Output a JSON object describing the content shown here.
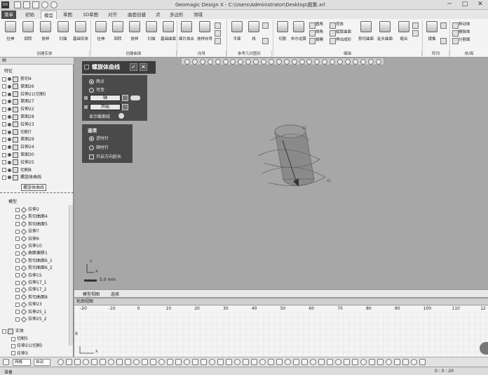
{
  "window": {
    "title": "Geomagic Design X - C:\\Users\\Administrator\\Desktop\\题集.xrl",
    "app_icon": "DX",
    "minimize": "─",
    "maximize": "□",
    "close": "✕"
  },
  "menu_tabs": [
    "菜单",
    "初始",
    "模型",
    "草图",
    "3D草图",
    "对齐",
    "曲面创建",
    "点",
    "多边形",
    "领域"
  ],
  "active_tab": "模型",
  "ribbon": {
    "create_solid": {
      "label": "创建实体",
      "buttons": [
        "拉伸",
        "回转",
        "放样",
        "扫描",
        "基础实体"
      ]
    },
    "create_surface": {
      "label": "创建曲面",
      "buttons": [
        "拉伸",
        "回转",
        "放样",
        "扫描",
        "基础曲面"
      ]
    },
    "wizard": {
      "label": "向导",
      "buttons": [
        "面片拟合",
        "放样向导"
      ]
    },
    "ref_geometry": {
      "label": "参考几何图形",
      "buttons": [
        "平面",
        "线"
      ]
    },
    "edit": {
      "label": "编辑",
      "buttons": [
        "切割",
        "布尔运算"
      ],
      "small": [
        "圆角",
        "倒角",
        "拔模",
        "壳体",
        "赋厚曲面",
        "押出成形"
      ]
    },
    "edit2": {
      "buttons": [
        "剪切曲面",
        "延长曲面",
        "缝合"
      ]
    },
    "array": {
      "label": "阵列",
      "buttons": [
        "镜像"
      ]
    },
    "body": {
      "label": "体/面",
      "small": [
        "移动体",
        "删除体",
        "分割面"
      ]
    }
  },
  "tree_panel": {
    "title": "树",
    "section_label": "特征",
    "features": [
      "剪切4",
      "草图26",
      "拉伸21(切割)",
      "草图27",
      "拉伸22",
      "草图28",
      "拉伸23",
      "切割7",
      "草图29",
      "拉伸24",
      "草图30",
      "拉伸25",
      "切割8",
      "螺旋体曲线"
    ],
    "tooltip": "螺旋体曲线",
    "model_label": "模型",
    "models": [
      "拉伸2",
      "剪切曲面4",
      "剪切曲面5",
      "拉伸7",
      "拉伸9",
      "拉伸10",
      "曲面偏移1",
      "剪切曲面6_1",
      "剪切曲面6_2",
      "拉伸15",
      "拉伸17_1",
      "拉伸17_2",
      "剪切曲面8",
      "拉伸23",
      "拉伸25_1",
      "拉伸25_2"
    ],
    "body_group": "实体",
    "bodies": [
      "切割5",
      "拉伸21(切割)",
      "拉伸3"
    ]
  },
  "helix_panel": {
    "title": "螺旋体曲线",
    "ok": "✓",
    "cancel": "✕",
    "method_on": "两点",
    "method_off": "可变",
    "axis_field": "轴",
    "start_field": "开始",
    "show_section": "显示截面线",
    "options_title": "选项",
    "opt_cw": "逆时针",
    "opt_ccw": "顺时针",
    "opt_reverse": "开启方向延长"
  },
  "view": {
    "scale_text": "5.0 mm",
    "axis_y": "Y",
    "axis_x": "X"
  },
  "bottom_tabs": [
    "模型视图",
    "选择"
  ],
  "profile": {
    "title": "轮廓视图",
    "ruler": [
      "-20",
      "-10",
      "0",
      "10",
      "20",
      "30",
      "40",
      "50",
      "60",
      "70",
      "80",
      "90",
      "100",
      "110",
      "12"
    ],
    "left_mark": "9",
    "axis_x": "X"
  },
  "bottom_toolbar": {
    "mode": "网格",
    "auto": "自动"
  },
  "status": {
    "left": "准备",
    "right": "0 : 0 : 20"
  }
}
